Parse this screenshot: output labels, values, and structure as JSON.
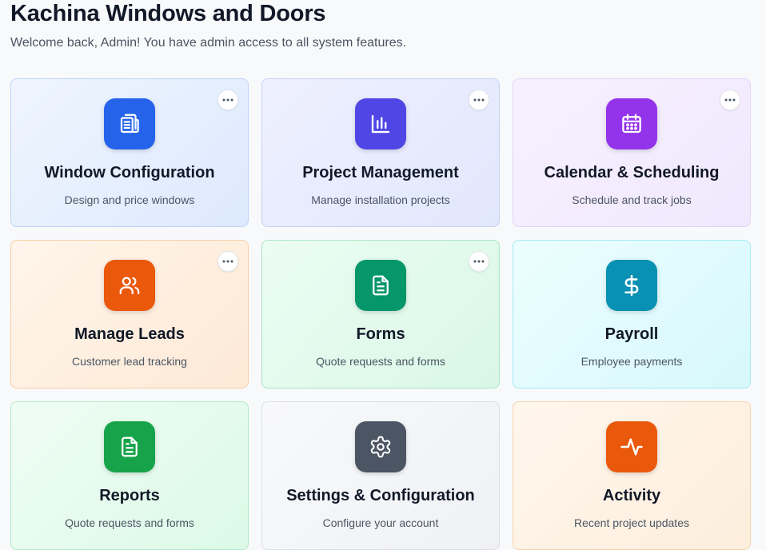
{
  "header": {
    "title": "Kachina Windows and Doors",
    "subtitle": "Welcome back, Admin! You have admin access to all system features."
  },
  "cards": [
    {
      "title": "Window Configuration",
      "description": "Design and price windows",
      "icon": "window-config-icon",
      "color": "#2563eb",
      "has_menu": true
    },
    {
      "title": "Project Management",
      "description": "Manage installation projects",
      "icon": "bar-chart-icon",
      "color": "#4f46e5",
      "has_menu": true
    },
    {
      "title": "Calendar & Scheduling",
      "description": "Schedule and track jobs",
      "icon": "calendar-icon",
      "color": "#9333ea",
      "has_menu": true
    },
    {
      "title": "Manage Leads",
      "description": "Customer lead tracking",
      "icon": "users-icon",
      "color": "#ea580c",
      "has_menu": true
    },
    {
      "title": "Forms",
      "description": "Quote requests and forms",
      "icon": "document-icon",
      "color": "#059669",
      "has_menu": true
    },
    {
      "title": "Payroll",
      "description": "Employee payments",
      "icon": "dollar-icon",
      "color": "#0891b2",
      "has_menu": false
    },
    {
      "title": "Reports",
      "description": "Quote requests and forms",
      "icon": "report-icon",
      "color": "#16a34a",
      "has_menu": false
    },
    {
      "title": "Settings & Configuration",
      "description": "Configure your account",
      "icon": "gear-icon",
      "color": "#4b5563",
      "has_menu": false
    },
    {
      "title": "Activity",
      "description": "Recent project updates",
      "icon": "activity-icon",
      "color": "#ea580c",
      "has_menu": false
    }
  ]
}
